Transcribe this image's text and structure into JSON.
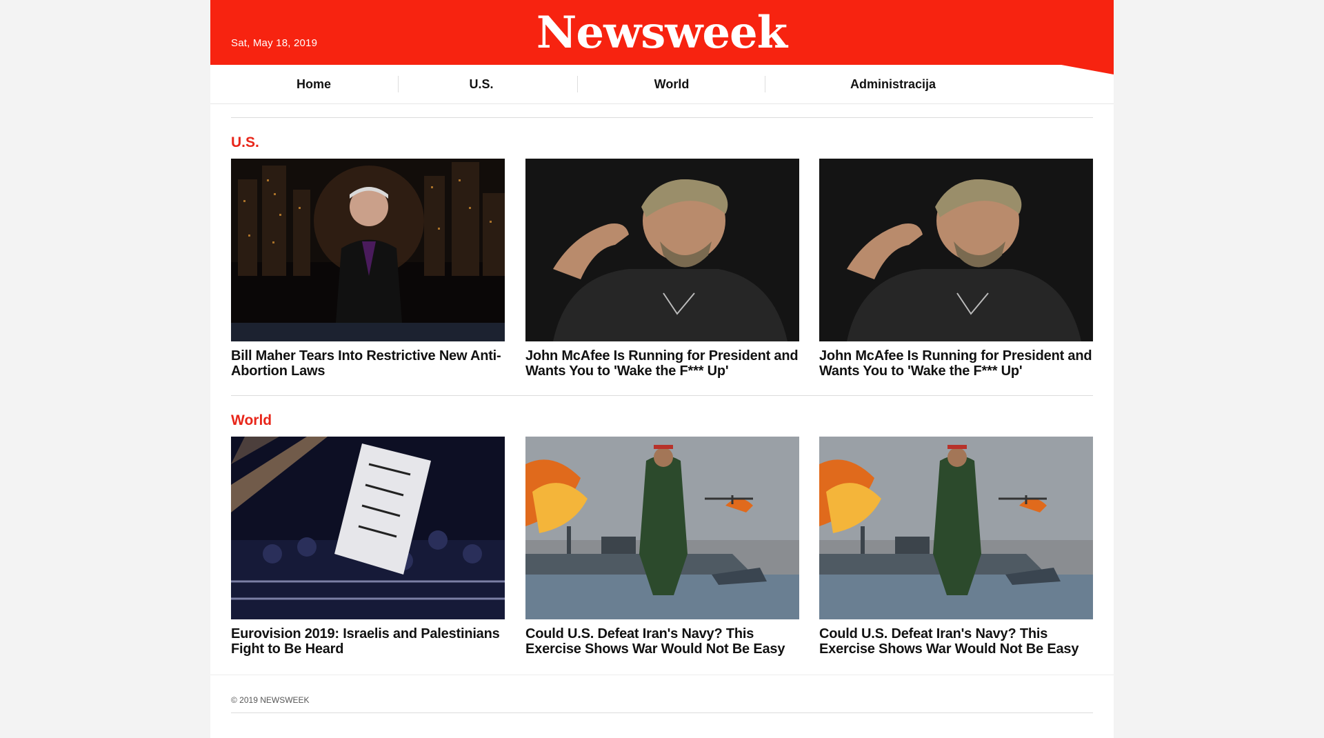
{
  "header": {
    "date": "Sat, May 18, 2019",
    "logo": "Newsweek",
    "logo_mark": "®",
    "brand_color": "#f72310"
  },
  "nav": {
    "items": [
      {
        "label": "Home"
      },
      {
        "label": "U.S."
      },
      {
        "label": "World"
      },
      {
        "label": "Administracija"
      }
    ]
  },
  "sections": [
    {
      "title": "U.S.",
      "articles": [
        {
          "title": "Bill Maher Tears Into Restrictive New Anti-Abortion Laws",
          "image": "tv-host-studio-photo"
        },
        {
          "title": "John McAfee Is Running for President and Wants You to 'Wake the F*** Up'",
          "image": "man-portrait-photo"
        },
        {
          "title": "John McAfee Is Running for President and Wants You to 'Wake the F*** Up'",
          "image": "man-portrait-photo"
        }
      ]
    },
    {
      "title": "World",
      "articles": [
        {
          "title": "Eurovision 2019: Israelis and Palestinians Fight to Be Heard",
          "image": "concert-protest-banner-photo"
        },
        {
          "title": "Could U.S. Defeat Iran's Navy? This Exercise Shows War Would Not Be Easy",
          "image": "navy-mural-photo"
        },
        {
          "title": "Could U.S. Defeat Iran's Navy? This Exercise Shows War Would Not Be Easy",
          "image": "navy-mural-photo"
        }
      ]
    }
  ],
  "footer": {
    "copyright": "© 2019 NEWSWEEK"
  }
}
